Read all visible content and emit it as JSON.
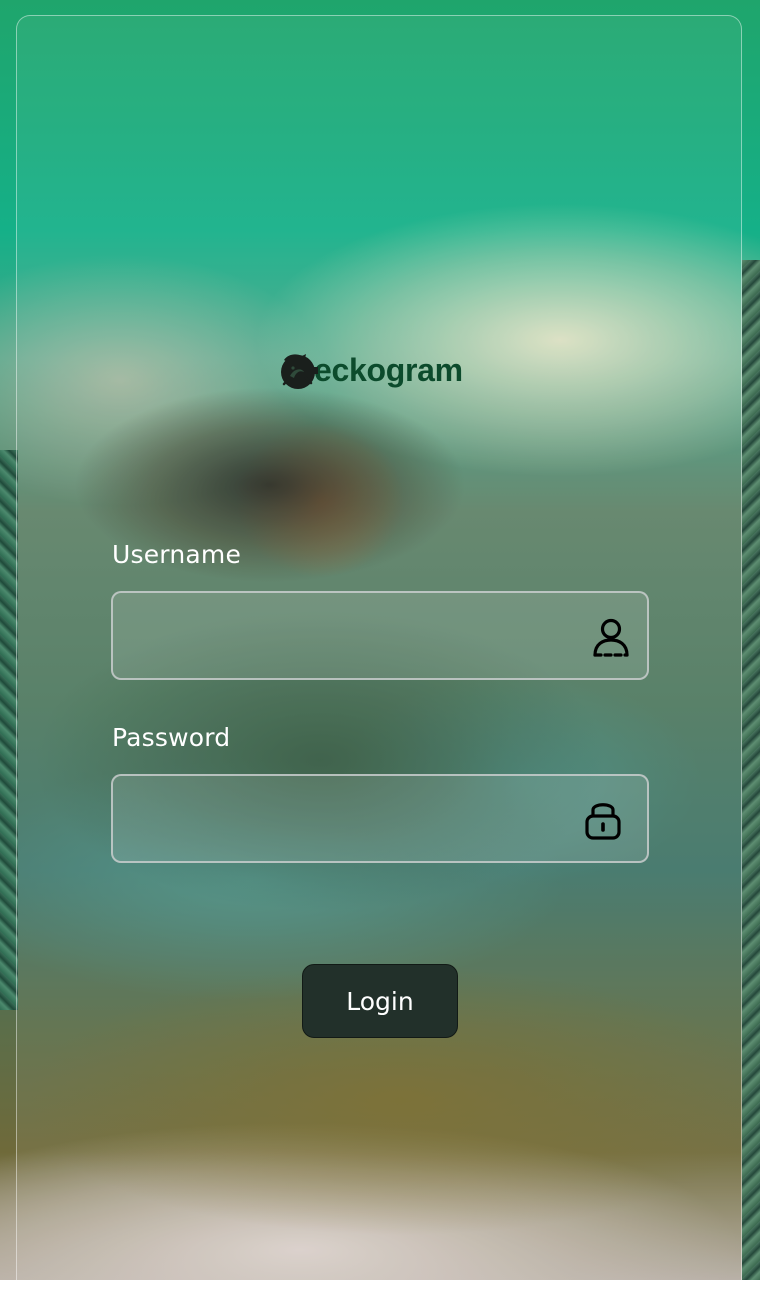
{
  "brand": {
    "logo_text": "eckogram",
    "logo_icon": "gecko-icon",
    "text_color": "#0c4b2c"
  },
  "form": {
    "username": {
      "label": "Username",
      "value": "",
      "icon": "user-icon"
    },
    "password": {
      "label": "Password",
      "value": "",
      "icon": "lock-icon"
    },
    "login_label": "Login"
  },
  "colors": {
    "button_bg": "#22302a",
    "label_text": "#ffffff"
  }
}
